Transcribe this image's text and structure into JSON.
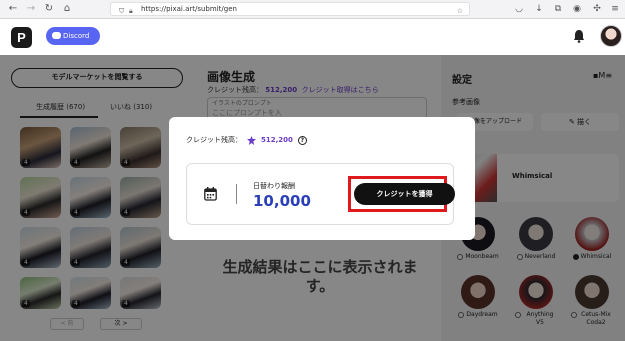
{
  "browser": {
    "url": "https://pixai.art/submit/gen"
  },
  "header": {
    "logo_letter": "P",
    "discord_label": "Discord"
  },
  "left_panel": {
    "model_market_button": "モデルマーケットを閲覧する",
    "tabs": [
      {
        "label": "生成履歴 (670)",
        "active": true
      },
      {
        "label": "いいね (310)",
        "active": false
      }
    ],
    "thumbs": [
      {
        "badge": "4"
      },
      {
        "badge": "4"
      },
      {
        "badge": "4"
      },
      {
        "badge": "4"
      },
      {
        "badge": "4"
      },
      {
        "badge": "4"
      },
      {
        "badge": "4"
      },
      {
        "badge": "4"
      },
      {
        "badge": "4"
      },
      {
        "badge": "4"
      },
      {
        "badge": "4"
      },
      {
        "badge": "4"
      }
    ],
    "prev_label": "< 前",
    "next_label": "次 >"
  },
  "center": {
    "title": "画像生成",
    "credit_label": "クレジット残高：",
    "credit_value": "512,200",
    "credit_link": "クレジット取得はこちら",
    "prompt_label": "イラストのプロンプト",
    "prompt_placeholder": "ここにプロンプトを入",
    "result_placeholder": "生成結果はここに表示されます。"
  },
  "right_panel": {
    "title": "設定",
    "ref_label": "参考画像",
    "upload_label": "画像をアップロード",
    "draw_label": "描く",
    "selected_model": "Whimsical",
    "models": [
      {
        "name": "Moonbeam",
        "selected": false
      },
      {
        "name": "Neverland",
        "selected": false
      },
      {
        "name": "Whimsical",
        "selected": true
      },
      {
        "name": "Daydream",
        "selected": false
      },
      {
        "name": "Anything V5",
        "selected": false
      },
      {
        "name": "Cetus-Mix Coda2",
        "selected": false
      }
    ]
  },
  "modal": {
    "credit_label": "クレジット残高：",
    "credit_value": "512,200",
    "daily_label": "日替わり報酬",
    "daily_value": "10,000",
    "get_credit_button": "クレジットを獲得"
  },
  "colors": {
    "accent_purple": "#6a3cc8",
    "discord": "#5865f2",
    "daily_blue": "#2a3fb8",
    "highlight_red": "#e0191f"
  }
}
